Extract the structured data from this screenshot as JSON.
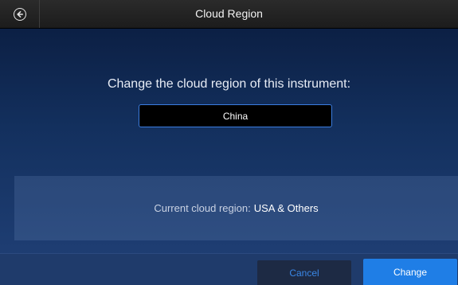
{
  "header": {
    "title": "Cloud Region",
    "back_icon": "back-arrow-icon"
  },
  "main": {
    "prompt": "Change the cloud region of this instrument:",
    "selected_region": "China"
  },
  "current": {
    "label": "Current cloud region:",
    "value": "USA & Others"
  },
  "footer": {
    "cancel_label": "Cancel",
    "change_label": "Change"
  },
  "colors": {
    "accent": "#1f7ee6",
    "field_border": "#3b7de0",
    "cancel_text": "#3a87e6"
  }
}
